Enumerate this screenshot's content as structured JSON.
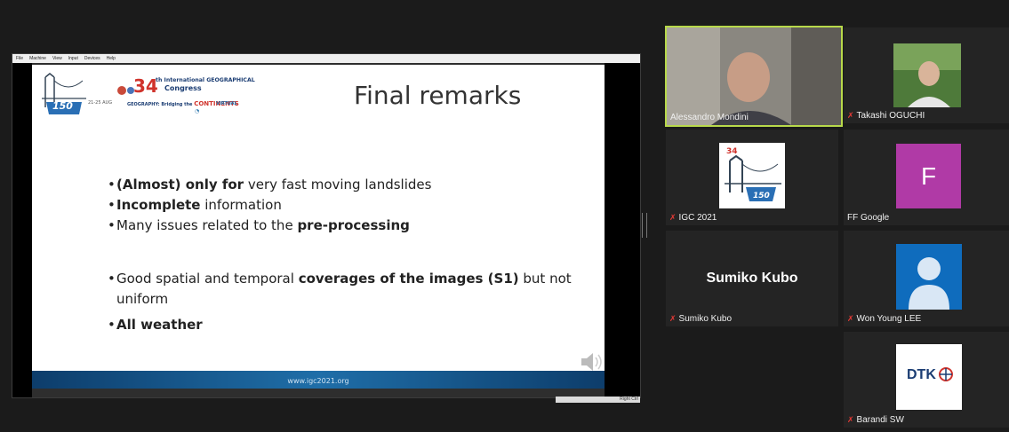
{
  "vm_menu": [
    "File",
    "Machine",
    "View",
    "Input",
    "Devices",
    "Help"
  ],
  "slide": {
    "title": "Final remarks",
    "logo_number": "34",
    "logo_line1": "th International GEOGRAPHICAL",
    "logo_line2": "Congress",
    "logo_tagline_a": "GEOGRAPHY: Bridging the ",
    "logo_tagline_b": "CONTINENTS",
    "logo_virtual": "VIRTUAL",
    "logo_150": "150",
    "bullets": [
      {
        "pre": "",
        "bold": "(Almost) only for",
        "post": " very fast moving landslides"
      },
      {
        "pre": "",
        "bold": "Incomplete",
        "post": " information"
      },
      {
        "pre": "Many issues related to the ",
        "bold": "pre-processing",
        "post": ""
      },
      {
        "pre": "Good spatial and temporal ",
        "bold": "coverages of the images (S1)",
        "post": " but not uniform"
      },
      {
        "pre": "",
        "bold": "All weather",
        "post": ""
      }
    ],
    "footer": "www.igc2021.org",
    "statusbar": "Right Ctrl"
  },
  "participants": [
    {
      "name": "Alessandro Mondini",
      "muted": false,
      "speaking": true
    },
    {
      "name": "Takashi OGUCHI",
      "muted": true
    },
    {
      "name": "IGC 2021",
      "muted": true
    },
    {
      "name": "FF Google",
      "muted": false,
      "initial": "F",
      "color": "#b03aa6"
    },
    {
      "name": "Sumiko Kubo",
      "muted": true,
      "bigname": "Sumiko Kubo"
    },
    {
      "name": "Won Young LEE",
      "muted": true
    },
    {
      "name": "Barandi SW",
      "muted": true,
      "logo": "DTK"
    }
  ],
  "colors": {
    "active_speaker_border": "#b8d94a",
    "muted_mic": "#e53935",
    "avatar_blue": "#0f6cbd"
  }
}
